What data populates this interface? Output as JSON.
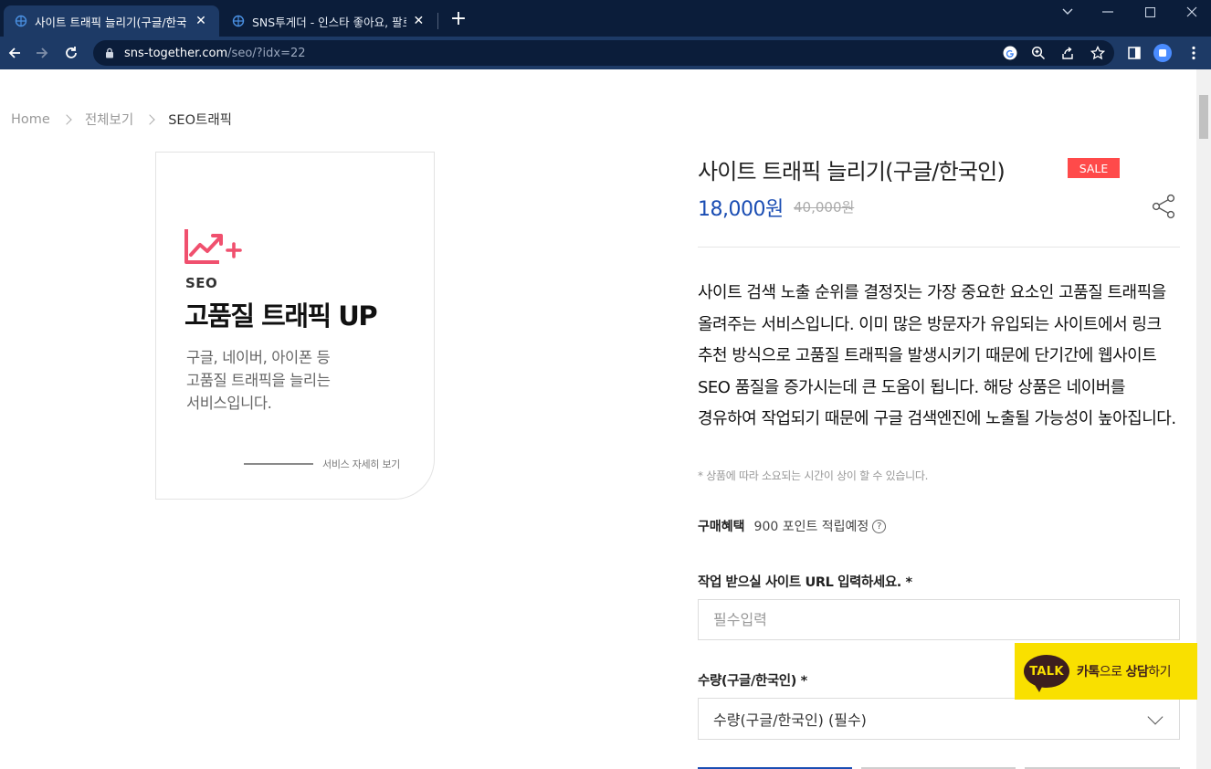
{
  "browser": {
    "tabs": [
      {
        "title": "사이트 트래픽 늘리기(구글/한국",
        "active": true
      },
      {
        "title": "SNS투게더 - 인스타 좋아요, 팔로",
        "active": false
      }
    ],
    "url_host": "sns-together.com",
    "url_path": "/seo/?idx=22"
  },
  "breadcrumb": {
    "home": "Home",
    "all": "전체보기",
    "current": "SEO트래픽"
  },
  "product_card": {
    "seo_label": "SEO",
    "headline": "고품질 트래픽 UP",
    "desc_line1": "구글, 네이버, 아이폰 등",
    "desc_line2": "고품질 트래픽을 늘리는",
    "desc_line3": "서비스입니다.",
    "more": "서비스 자세히 보기"
  },
  "product": {
    "title": "사이트 트래픽 늘리기(구글/한국인)",
    "badge": "SALE",
    "price": "18,000원",
    "original_price": "40,000원",
    "description": "사이트 검색 노출 순위를 결정짓는 가장 중요한 요소인 고품질 트래픽을 올려주는 서비스입니다. 이미 많은 방문자가 유입되는 사이트에서 링크 추천 방식으로 고품질 트래픽을 발생시키기 때문에 단기간에 웹사이트 SEO 품질을 증가시는데 큰 도움이 됩니다. 해당 상품은 네이버를 경유하여 작업되기 때문에 구글 검색엔진에 노출될 가능성이 높아집니다.",
    "note": "* 상품에 따라 소요되는 시간이 상이 할 수 있습니다."
  },
  "benefit": {
    "label": "구매혜택",
    "value": "900 포인트 적립예정"
  },
  "form": {
    "url_label": "작업 받으실 사이트 URL 입력하세요. *",
    "url_placeholder": "필수입력",
    "qty_label": "수량(구글/한국인) *",
    "qty_selected": "수량(구글/한국인) (필수)"
  },
  "kakao": {
    "bubble": "TALK",
    "text_bold1": "카톡",
    "text_mid": "으로 ",
    "text_bold2": "상담",
    "text_end": "하기"
  },
  "colors": {
    "accent_blue": "#1a4db3",
    "sale_red": "#ff4a4a",
    "kakao_yellow": "#f9e000",
    "chrome_dark": "#0b1d3a"
  }
}
